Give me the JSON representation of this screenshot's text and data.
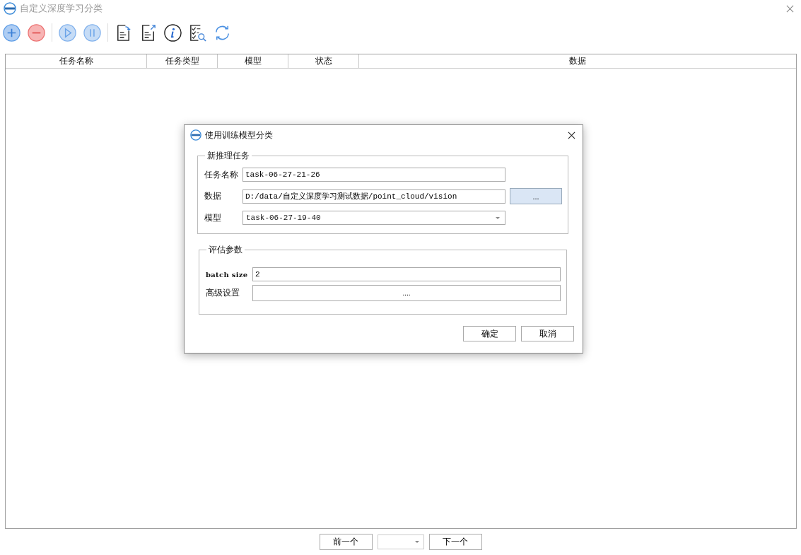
{
  "window": {
    "title": "自定义深度学习分类"
  },
  "table": {
    "columns": [
      "任务名称",
      "任务类型",
      "模型",
      "状态",
      "数据"
    ]
  },
  "pager": {
    "previous": "前一个",
    "next": "下一个"
  },
  "dialog": {
    "title": "使用训练模型分类",
    "groups": [
      {
        "title": "新推理任务",
        "fields": [
          {
            "kind": "text",
            "label": "任务名称",
            "value": "task-06-27-21-26"
          },
          {
            "kind": "browse",
            "label": "数据",
            "value": "D:/data/自定义深度学习测试数据/point_cloud/vision",
            "button": "..."
          },
          {
            "kind": "select",
            "label": "模型",
            "value": "task-06-27-19-40"
          }
        ]
      },
      {
        "title": "评估参数",
        "fields": [
          {
            "kind": "text",
            "label": "batch size",
            "value": "2"
          },
          {
            "kind": "button",
            "label": "高级设置",
            "button": "...."
          }
        ]
      }
    ],
    "buttons": [
      "确定",
      "取消"
    ]
  }
}
